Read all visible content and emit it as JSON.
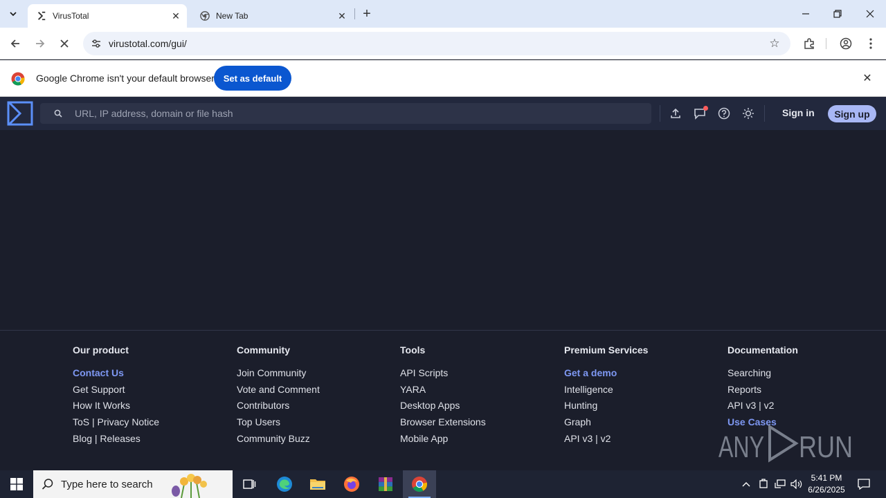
{
  "browser": {
    "tabs": [
      {
        "title": "VirusTotal",
        "icon": "virustotal-favicon",
        "active": true
      },
      {
        "title": "New Tab",
        "icon": "chrome-favicon",
        "active": false
      }
    ],
    "address_bar": {
      "url": "virustotal.com/gui/"
    },
    "infobar": {
      "message": "Google Chrome isn't your default browser",
      "button_label": "Set as default"
    }
  },
  "vt_header": {
    "search_placeholder": "URL, IP address, domain or file hash",
    "sign_in": "Sign in",
    "sign_up": "Sign up",
    "icons": [
      "upload-icon",
      "chat-icon",
      "help-icon",
      "theme-toggle-icon"
    ]
  },
  "footer": {
    "columns": [
      {
        "heading": "Our product",
        "links": [
          "Contact Us",
          "Get Support",
          "How It Works",
          "ToS | Privacy Notice",
          "Blog | Releases"
        ]
      },
      {
        "heading": "Community",
        "links": [
          "Join Community",
          "Vote and Comment",
          "Contributors",
          "Top Users",
          "Community Buzz"
        ]
      },
      {
        "heading": "Tools",
        "links": [
          "API Scripts",
          "YARA",
          "Desktop Apps",
          "Browser Extensions",
          "Mobile App"
        ]
      },
      {
        "heading": "Premium Services",
        "links": [
          "Get a demo",
          "Intelligence",
          "Hunting",
          "Graph",
          "API v3 | v2"
        ]
      },
      {
        "heading": "Documentation",
        "links": [
          "Searching",
          "Reports",
          "API v3 | v2",
          "Use Cases"
        ]
      }
    ],
    "watermark": "ANY RUN"
  },
  "taskbar": {
    "search_placeholder": "Type here to search",
    "time": "5:41 PM",
    "date": "6/26/2025"
  },
  "colors": {
    "vt_background": "#1b1e2b",
    "vt_header": "#22283d",
    "accent_link": "#7e98f3",
    "signup_button": "#a8b7f5",
    "chrome_button": "#0b57d0"
  }
}
